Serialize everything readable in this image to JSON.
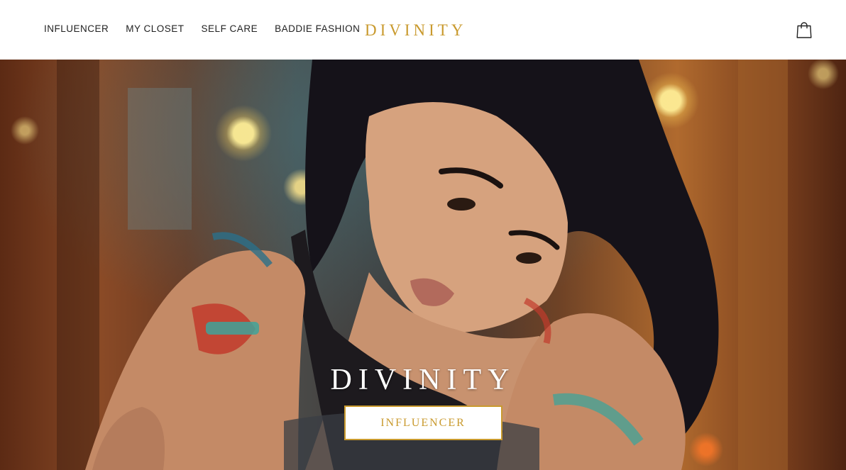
{
  "brand": {
    "name": "DIVINITY",
    "accent_color": "#c99a2e"
  },
  "nav": {
    "items": [
      {
        "label": "INFLUENCER"
      },
      {
        "label": "MY CLOSET"
      },
      {
        "label": "SELF CARE"
      },
      {
        "label": "BADDIE FASHION"
      }
    ]
  },
  "header": {
    "cart_icon": "shopping-bag-icon"
  },
  "hero": {
    "image_subject": "photo of tattooed woman with dark wavy hair leaning forward, blurred street background with bokeh lights",
    "title": "DIVINITY",
    "button_label": "INFLUENCER"
  }
}
